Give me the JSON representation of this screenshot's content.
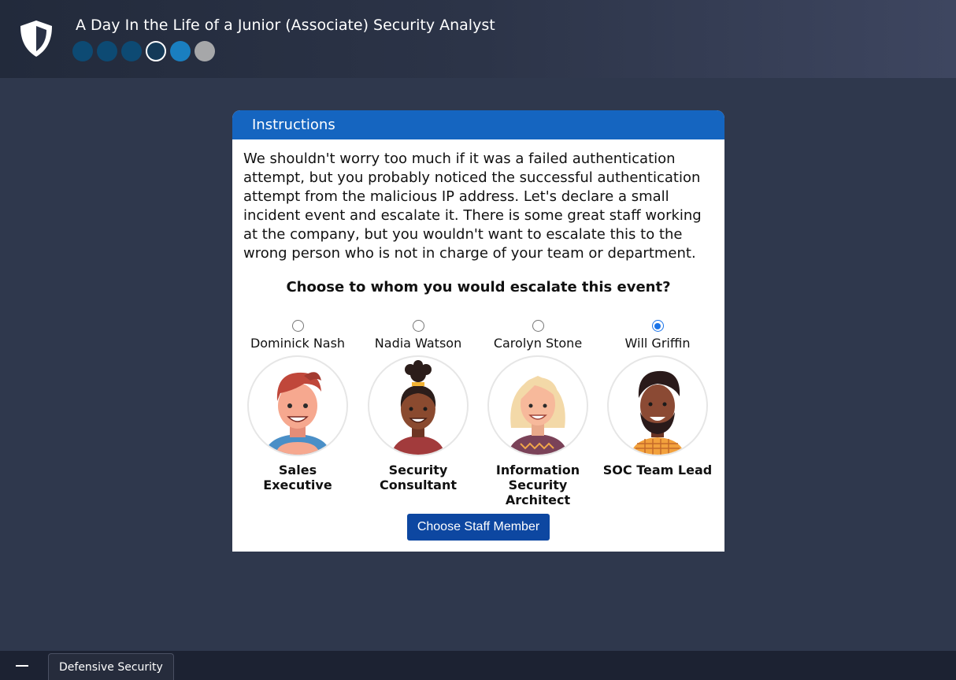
{
  "app": {
    "title": "A Day In the Life of a Junior (Associate) Security Analyst",
    "progress": [
      "done",
      "done",
      "done",
      "current",
      "next",
      "todo"
    ],
    "colors": {
      "header": "#222a3b",
      "background": "#2f384d",
      "card_header": "#1565c0",
      "button": "#0d47a1"
    }
  },
  "card": {
    "header": "Instructions",
    "instructions": "We shouldn't worry too much if it was a failed authentication attempt, but you probably noticed the successful authentication attempt from the malicious IP address. Let's declare a small incident event and escalate it. There is some great staff working at the company, but you wouldn't want to escalate this to the wrong person who is not in charge of your team or department.",
    "question": "Choose to whom you would escalate this event?",
    "staff": [
      {
        "name": "Dominick Nash",
        "role": "Sales Executive",
        "selected": false
      },
      {
        "name": "Nadia Watson",
        "role": "Security Consultant",
        "selected": false
      },
      {
        "name": "Carolyn Stone",
        "role": "Information Security Architect",
        "selected": false
      },
      {
        "name": "Will Griffin",
        "role": "SOC Team Lead",
        "selected": true
      }
    ],
    "button_label": "Choose Staff Member"
  },
  "taskbar": {
    "tab_label": "Defensive Security"
  }
}
